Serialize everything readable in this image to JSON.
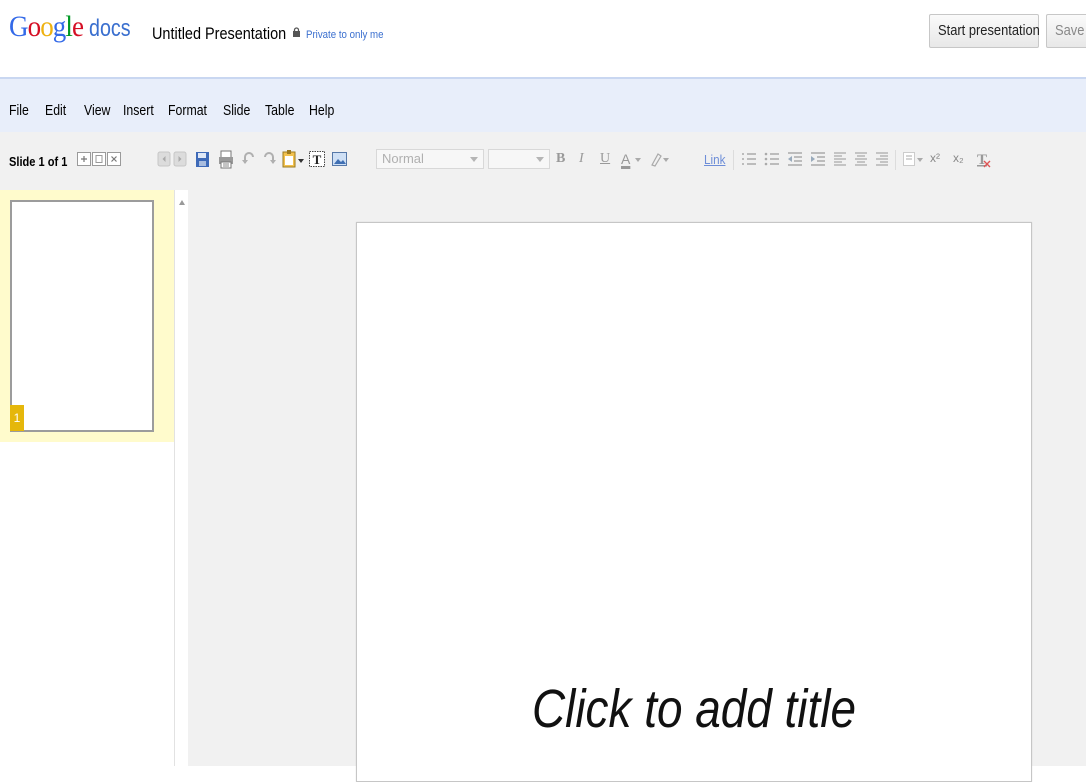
{
  "app": {
    "logo_google": "Google",
    "logo_docs": "docs",
    "doc_title": "Untitled Presentation",
    "privacy": "Private to only me"
  },
  "header_buttons": {
    "start_presentation": "Start presentation",
    "save": "Save"
  },
  "menu": [
    "File",
    "Edit",
    "View",
    "Insert",
    "Format",
    "Slide",
    "Table",
    "Help"
  ],
  "toolbar": {
    "slide_counter": "Slide 1 of 1",
    "style_dropdown": "Normal",
    "font_size_dropdown": "",
    "bold": "B",
    "italic": "I",
    "underline": "U",
    "text_color": "A",
    "link": "Link",
    "superscript": "x²",
    "subscript": "x₂",
    "clear_format": "T"
  },
  "filmstrip": {
    "slides": [
      {
        "number": "1"
      }
    ],
    "selected_color": "#fffbcc",
    "number_badge_color": "#e5b70b"
  },
  "slide": {
    "title_placeholder": "Click to add title"
  },
  "colors": {
    "menubar_bg": "#e8eefa",
    "header_rule": "#c9d7f1",
    "link_blue": "#3a6fcf"
  }
}
